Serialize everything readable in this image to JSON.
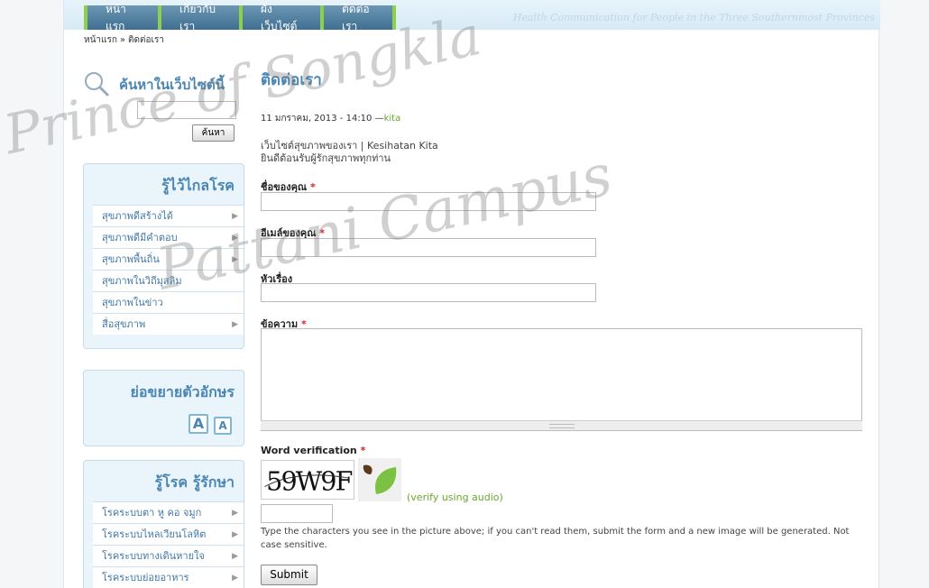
{
  "nav": {
    "items": [
      "หน้าแรก",
      "เกี่ยวกับเรา",
      "ผังเว็บไซต์",
      "ติดต่อเรา"
    ],
    "tagline": "Health Communication for People in the Three Southernmost Provinces"
  },
  "breadcrumb": {
    "home": "หน้าแรก",
    "sep": "»",
    "current": "ติดต่อเรา"
  },
  "search": {
    "title": "ค้นหาในเว็บไซต์นี้",
    "button": "ค้นหา",
    "value": ""
  },
  "health_block": {
    "title": "รู้ไว้ไกลโรค",
    "items": [
      {
        "label": "สุขภาพดีสร้างได้",
        "has_arrow": true
      },
      {
        "label": "สุขภาพดีมีคำตอบ",
        "has_arrow": true
      },
      {
        "label": "สุขภาพพื้นถิ่น",
        "has_arrow": true
      },
      {
        "label": "สุขภาพในวิถีมุสลิม",
        "has_arrow": false
      },
      {
        "label": "สุขภาพในข่าว",
        "has_arrow": false
      },
      {
        "label": "สื่อสุขภาพ",
        "has_arrow": true
      }
    ]
  },
  "font_block": {
    "title": "ย่อขยายตัวอักษร",
    "plus": "A",
    "minus": "A"
  },
  "disease_block": {
    "title": "รู้โรค รู้รักษา",
    "items": [
      {
        "label": "โรคระบบตา หู คอ จมูก"
      },
      {
        "label": "โรคระบบไหลเวียนโลหิต"
      },
      {
        "label": "โรคระบบทางเดินหายใจ"
      },
      {
        "label": "โรคระบบย่อยอาหาร"
      }
    ]
  },
  "main": {
    "title": "ติดต่อเรา",
    "submitted_date": "11 มกราคม, 2013 - 14:10",
    "submitted_sep": "—",
    "author": "kita",
    "intro_line1": "เว็บไซต์สุขภาพของเรา | Kesihatan Kita",
    "intro_line2": "ยินดีต้อนรับผู้รักสุขภาพทุกท่าน",
    "fields": {
      "name_label": "ชื่อของคุณ",
      "email_label": "อีเมล์ของคุณ",
      "subject_label": "หัวเรื่อง",
      "message_label": "ข้อความ",
      "name_value": "",
      "email_value": "",
      "subject_value": "",
      "message_value": ""
    },
    "required_mark": "*",
    "captcha": {
      "label": "Word verification",
      "image_text": "59W9F",
      "audio_link": "(verify using audio)",
      "value": "",
      "description": "Type the characters you see in the picture above; if you can't read them, submit the form and a new image will be generated. Not case sensitive."
    },
    "submit_label": "Submit"
  },
  "watermark": {
    "line1": "Prince of Songkla",
    "line2": "Pattani Campus"
  },
  "colors": {
    "accent": "#4a86b4",
    "link": "#6aa82b",
    "nav": "#3f6f92",
    "nav_divider": "#8ed04a"
  }
}
